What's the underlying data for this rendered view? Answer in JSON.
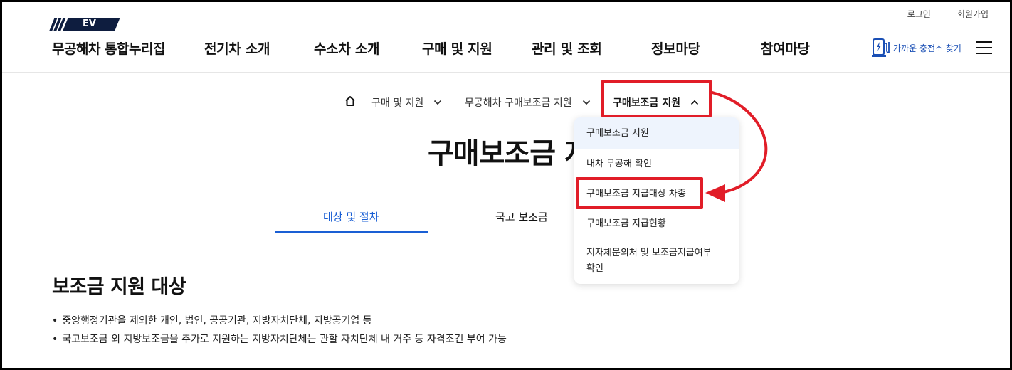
{
  "header": {
    "utility": {
      "login": "로그인",
      "signup": "회원가입"
    },
    "logo": {
      "mark": "EV",
      "text": "무공해차 통합누리집"
    },
    "nav": [
      "전기차 소개",
      "수소차 소개",
      "구매 및 지원",
      "관리 및 조회",
      "정보마당",
      "참여마당"
    ],
    "charger_link": {
      "label": "가까운 충전소 찾기",
      "icon": "ev-charger-icon"
    },
    "menu_icon": "hamburger-icon"
  },
  "breadcrumb": {
    "home_icon": "home-icon",
    "items": [
      "구매 및 지원",
      "무공해차 구매보조금 지원",
      "구매보조금 지원"
    ]
  },
  "dropdown": {
    "items": [
      "구매보조금 지원",
      "내차 무공해 확인",
      "구매보조금 지급대상 차종",
      "구매보조금 지급현황",
      "지자체문의처 및 보조금지급여부 확인"
    ],
    "active_index": 0
  },
  "page": {
    "title": "구매보조금 지",
    "tabs": [
      "대상 및 절차",
      "국고 보조금"
    ],
    "active_tab": 0
  },
  "section": {
    "title": "보조금 지원 대상",
    "bullets": [
      "중앙행정기관을 제외한 개인, 법인, 공공기관, 지방자치단체, 지방공기업 등",
      "국고보조금 외 지방보조금을 추가로 지원하는 지방자치단체는 관할 자치단체 내 거주 등 자격조건 부여 가능"
    ]
  },
  "colors": {
    "accent": "#1a5fd4",
    "highlight": "#e11d28",
    "logo_navy": "#0e1d3f"
  }
}
